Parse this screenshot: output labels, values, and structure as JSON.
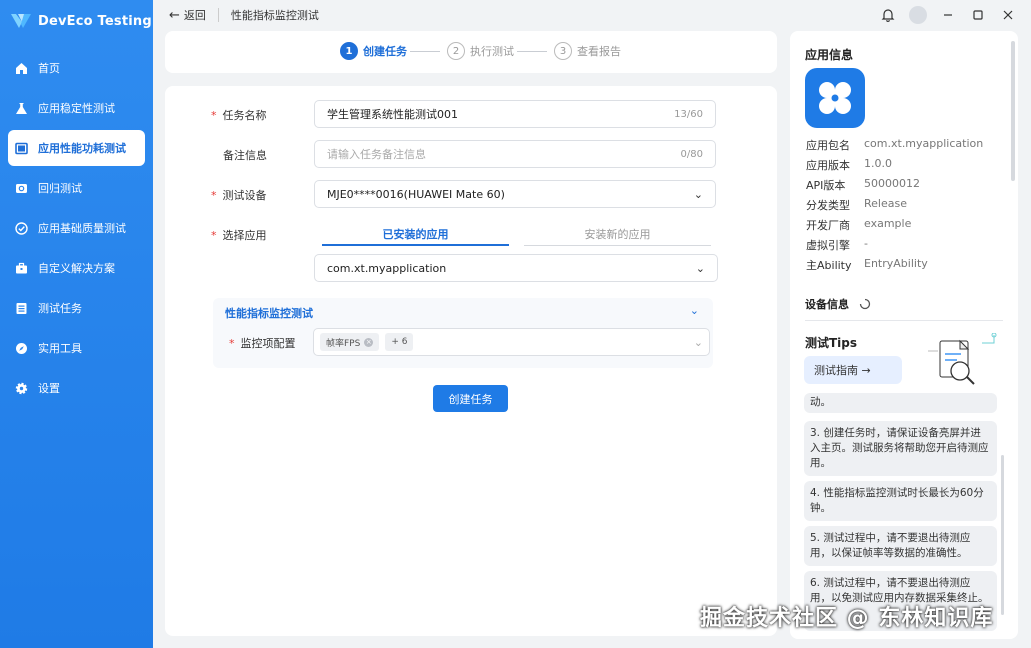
{
  "app": {
    "brand": "DevEco Testing"
  },
  "sidebar": {
    "items": [
      {
        "label": "首页",
        "icon": "home-icon"
      },
      {
        "label": "应用稳定性测试",
        "icon": "flask-icon"
      },
      {
        "label": "应用性能功耗测试",
        "icon": "monitor-icon",
        "active": true
      },
      {
        "label": "回归测试",
        "icon": "regression-icon"
      },
      {
        "label": "应用基础质量测试",
        "icon": "check-circle-icon"
      },
      {
        "label": "自定义解决方案",
        "icon": "briefcase-icon"
      },
      {
        "label": "测试任务",
        "icon": "list-icon"
      },
      {
        "label": "实用工具",
        "icon": "compass-icon"
      },
      {
        "label": "设置",
        "icon": "gear-icon"
      }
    ]
  },
  "topbar": {
    "back_label": "返回",
    "page_title": "性能指标监控测试"
  },
  "stepper": {
    "steps": [
      {
        "num": "1",
        "label": "创建任务",
        "active": true
      },
      {
        "num": "2",
        "label": "执行测试",
        "active": false
      },
      {
        "num": "3",
        "label": "查看报告",
        "active": false
      }
    ]
  },
  "form": {
    "task_name": {
      "label": "任务名称",
      "value": "学生管理系统性能测试001",
      "count": "13/60"
    },
    "remark": {
      "label": "备注信息",
      "placeholder": "请输入任务备注信息",
      "count": "0/80"
    },
    "device": {
      "label": "测试设备",
      "value": "MJE0****0016(HUAWEI Mate 60)"
    },
    "app_select": {
      "label": "选择应用",
      "tabs": [
        "已安装的应用",
        "安装新的应用"
      ],
      "value": "com.xt.myapplication"
    },
    "section": {
      "title": "性能指标监控测试",
      "monitor_label": "监控项配置",
      "chip": "帧率FPS",
      "more": "+ 6"
    },
    "create_button": "创建任务"
  },
  "right_panel": {
    "app_info_title": "应用信息",
    "app_info": [
      {
        "k": "应用包名",
        "v": "com.xt.myapplication"
      },
      {
        "k": "应用版本",
        "v": "1.0.0"
      },
      {
        "k": "API版本",
        "v": "50000012"
      },
      {
        "k": "分发类型",
        "v": "Release"
      },
      {
        "k": "开发厂商",
        "v": "example"
      },
      {
        "k": "虚拟引擎",
        "v": "-"
      },
      {
        "k": "主Ability",
        "v": "EntryAbility"
      }
    ],
    "device_info_title": "设备信息",
    "tips_title": "测试Tips",
    "guide_button": "测试指南 →",
    "tips": [
      "动。",
      "3. 创建任务时，请保证设备亮屏并进入主页。测试服务将帮助您开启待测应用。",
      "4. 性能指标监控测试时长最长为60分钟。",
      "5. 测试过程中，请不要退出待测应用，以保证帧率等数据的准确性。",
      "6. 测试过程中，请不要退出待测应用，以免测试应用内存数据采集终止。"
    ]
  },
  "watermark": "掘金技术社区 @ 东林知识库",
  "colors": {
    "accent": "#1f7be6",
    "required": "#e53935"
  }
}
